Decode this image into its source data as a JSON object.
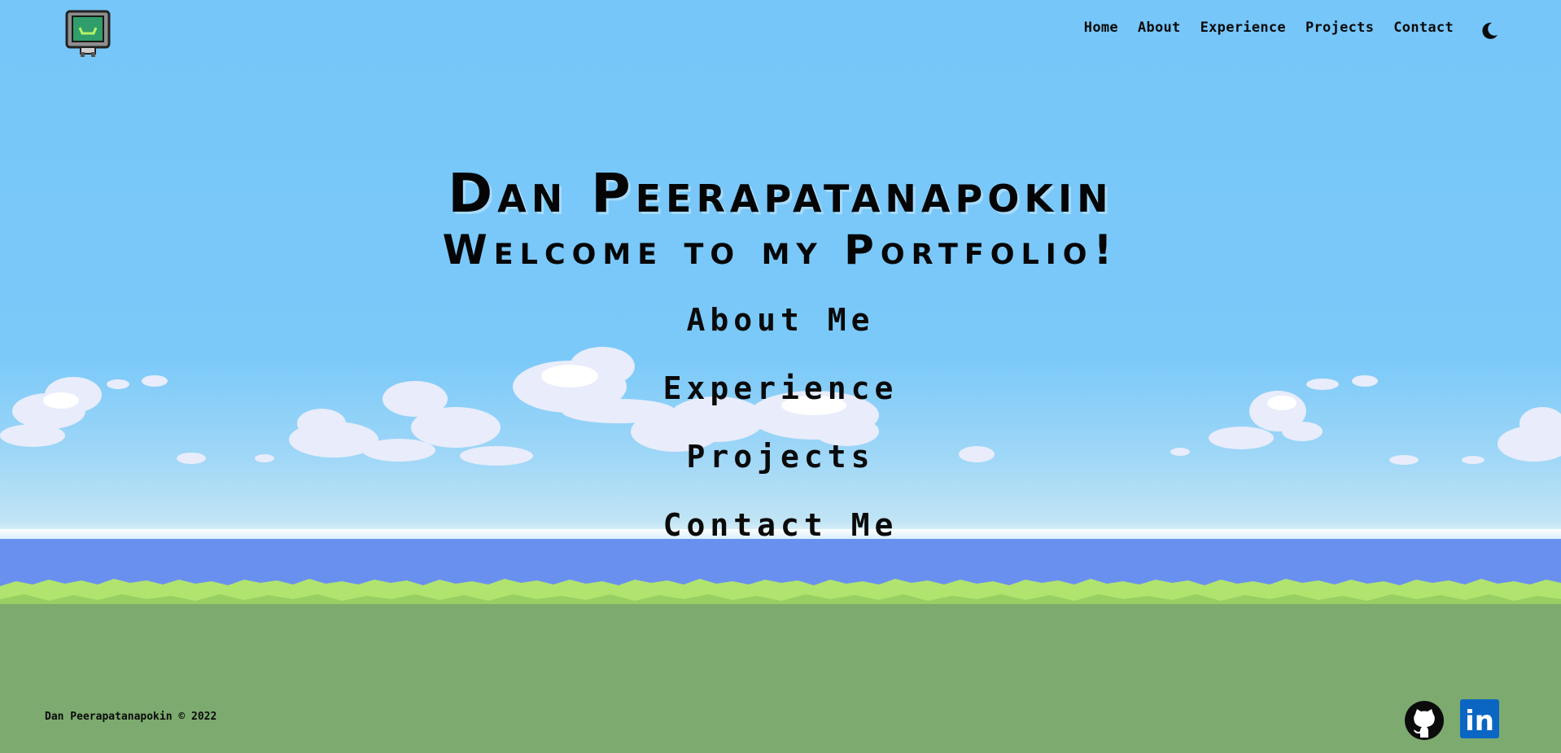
{
  "header": {
    "logo_icon": "robot-computer-icon",
    "nav": [
      {
        "label": "Home"
      },
      {
        "label": "About"
      },
      {
        "label": "Experience"
      },
      {
        "label": "Projects"
      },
      {
        "label": "Contact"
      }
    ],
    "theme_toggle_icon": "moon-icon"
  },
  "hero": {
    "title": "Dan Peerapatanapokin",
    "subtitle": "Welcome to my Portfolio!",
    "menu": [
      {
        "label": "About Me"
      },
      {
        "label": "Experience"
      },
      {
        "label": "Projects"
      },
      {
        "label": "Contact Me"
      }
    ]
  },
  "footer": {
    "copyright": "Dan Peerapatanapokin © 2022",
    "social": [
      {
        "icon": "github-icon"
      },
      {
        "icon": "linkedin-icon",
        "label": "in"
      }
    ]
  },
  "colors": {
    "sky": "#79c8fa",
    "sea": "#6a90ef",
    "grass": "#b1e46e",
    "ground": "#7daa6f",
    "linkedin": "#0a66c2"
  }
}
